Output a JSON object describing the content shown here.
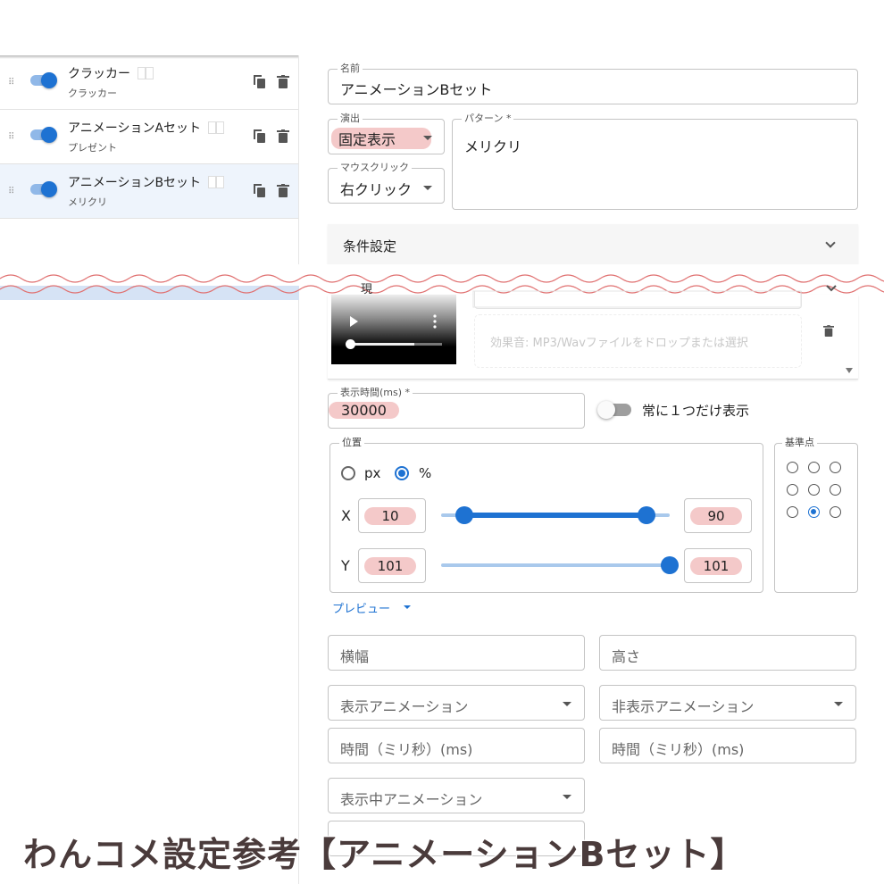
{
  "list": {
    "items": [
      {
        "title": "クラッカー",
        "subtitle": "クラッカー",
        "selected": false,
        "enabled": true
      },
      {
        "title": "アニメーションAセット",
        "subtitle": "プレゼント",
        "selected": false,
        "enabled": true
      },
      {
        "title": "アニメーションBセット",
        "subtitle": "メリクリ",
        "selected": true,
        "enabled": true
      }
    ]
  },
  "form": {
    "name_label": "名前",
    "name_value": "アニメーションBセット",
    "effect_label": "演出",
    "effect_value": "固定表示",
    "pattern_label": "パターン *",
    "pattern_value": "メリクリ",
    "mouse_label": "マウスクリック",
    "mouse_value": "右クリック",
    "conditions_title": "条件設定",
    "sound_drop_placeholder": "効果音: MP3/Wavファイルをドロップまたは選択",
    "display_time_label": "表示時間(ms) *",
    "display_time_value": "30000",
    "always_one_label": "常に１つだけ表示",
    "always_one_on": false,
    "position_legend": "位置",
    "unit_options": [
      "px",
      "%"
    ],
    "unit_selected": "%",
    "x_label": "X",
    "x_min": "10",
    "x_max": "90",
    "y_label": "Y",
    "y_min": "101",
    "y_max": "101",
    "x_range_fraction": [
      0.1,
      0.9
    ],
    "y_range_fraction": [
      1.0,
      1.0
    ],
    "anchor_legend": "基準点",
    "anchor_selected": "bottom-center",
    "preview_label": "プレビュー",
    "width_placeholder": "横幅",
    "height_placeholder": "高さ",
    "show_anim_placeholder": "表示アニメーション",
    "hide_anim_placeholder": "非表示アニメーション",
    "show_time_placeholder": "時間（ミリ秒）(ms)",
    "hide_time_placeholder": "時間（ミリ秒）(ms)",
    "during_anim_placeholder": "表示中アニメーション"
  },
  "banner": "わんコメ設定参考【アニメーションBセット】",
  "colors": {
    "accent": "#1e72d2",
    "highlight": "#f4c9c9",
    "wave": "#e07070",
    "banner_text": "#4a3b3b"
  }
}
